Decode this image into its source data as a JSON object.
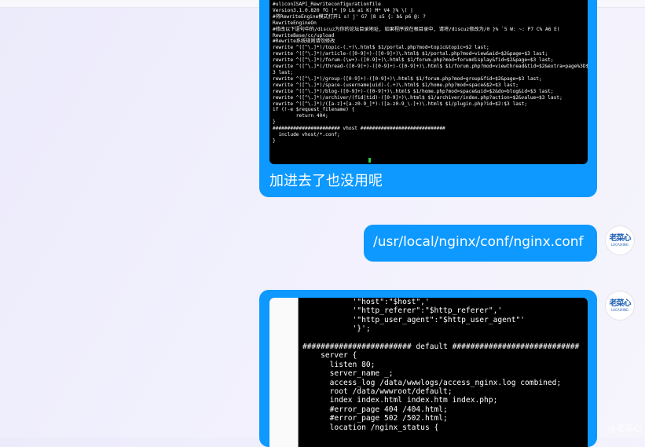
{
  "messages": [
    {
      "terminal_lines": [
        "#uliconISAPI_Rewriteconfigurationfile",
        "Version3.1.0.820 fG |* |9 L& a1 K) M* V4 }% \\( |",
        "#将RewriteEngine模式打开1 s! j' G7 |8 s5 {: b& p6 @: ?",
        "RewriteEngineOn",
        "#修改以下语句中的/discuz为你的论坛目录地址, 如果程序放在根目录中, 请将/discuz修改为/0 }% `5 W: ~: P7 C% A6 E(",
        "RewriteBase/cc/upload",
        "#Rewrite系统规则请勿修改",
        "rewrite ^([^\\.]*)/topic-(.+)\\.html$ $1/portal.php?mod=topic&topic=$2 last;",
        "rewrite ^([^\\.]*)/article-([0-9]+)-([0-9]+)\\.html$ $1/portal.php?mod=view&aid=$2&page=$3 last;",
        "rewrite ^([^\\.]*)/forum-(\\w+)-([0-9]+)\\.html$ $1/forum.php?mod=forumdisplay&fid=$2&page=$3 last;",
        "rewrite ^([^\\.]*)/thread-([0-9]+)-([0-9]+)-([0-9]+)\\.html$ $1/forum.php?mod=viewthread&tid=$2&extra=page%3D$4&page=$",
        "3 last;",
        "rewrite ^([^\\.]*)/group-([0-9]+)-([0-9]+)\\.html$ $1/forum.php?mod=group&fid=$2&page=$3 last;",
        "rewrite ^([^\\.]*)/space-(username|uid)-(.+)\\.html$ $1/home.php?mod=space&$2=$3 last;",
        "rewrite ^([^\\.]*)/blog-([0-9]+)-([0-9]+)\\.html$ $1/home.php?mod=space&uid=$2&do=blog&id=$3 last;",
        "rewrite ^([^\\.]*)/archiver/(fid|tid)-([0-9]+)\\.html$ $1/archiver/index.php?action=$2&value=$3 last;",
        "rewrite ^([^\\.]*)/([a-z]+[a-z0-9_]*)-([a-z0-9_\\-]+)\\.html$ $1/plugin.php?id=$2:$3 last;",
        "if (!-e $request_filename) {",
        "        return 404;",
        "}",
        "####################### vhost #############################",
        "  include vhost/*.conf;",
        "}"
      ],
      "caption": "加进去了也没用呢"
    },
    {
      "text": "/usr/local/nginx/conf/nginx.conf"
    },
    {
      "terminal_lines": [
        "           '\"host\":\"$host\",'",
        "           '\"http_referer\":\"$http_referer\",'",
        "           '\"http_user_agent\":\"$http_user_agent\"'",
        "           '}';",
        "",
        "######################## default ############################",
        "    server {",
        "      listen 80;",
        "      server_name _;",
        "      access_log /data/wwwlogs/access_nginx.log combined;",
        "      root /data/wwwroot/default;",
        "      index index.html index.htm index.php;",
        "      #error_page 404 /404.html;",
        "      #error_page 502 /502.html;",
        "      location /nginx_status {"
      ]
    }
  ],
  "avatar": {
    "name": "老菜心",
    "subtitle": "LUCAIXING"
  },
  "watermark": "@老菜心"
}
